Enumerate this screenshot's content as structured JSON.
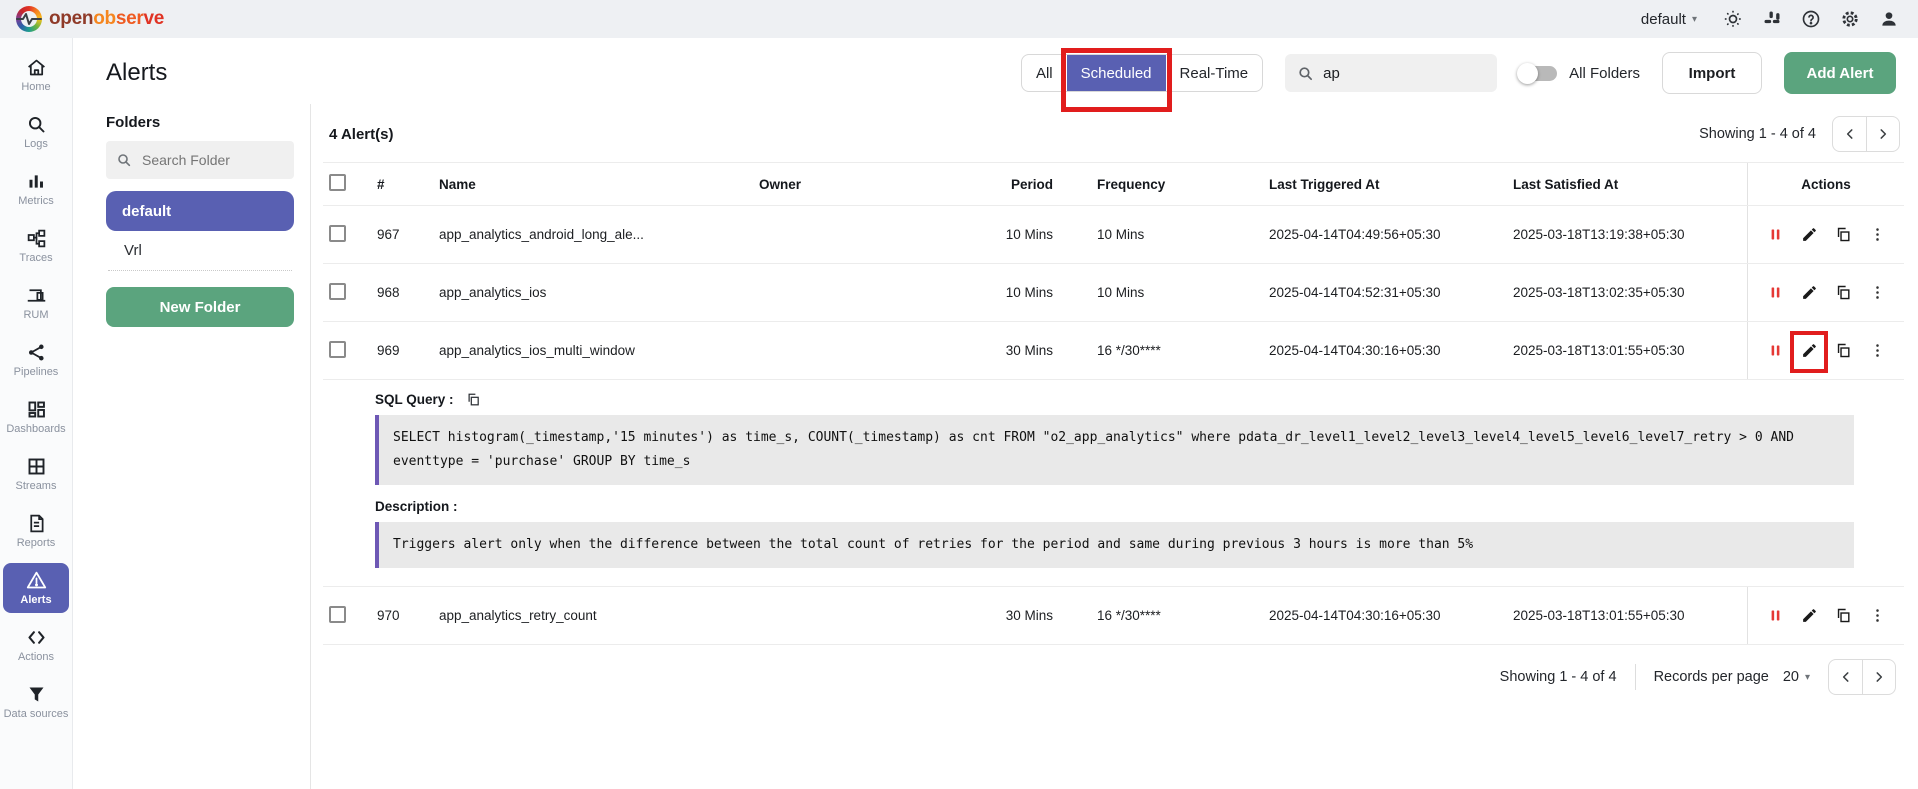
{
  "colors": {
    "accent_purple": "#5960b2",
    "button_green": "#5ba47e",
    "annotation_red": "#e11d1d",
    "pause_icon_red": "#e53935",
    "code_block_border_purple": "#6e58b5"
  },
  "topbar": {
    "brand_open": "open",
    "brand_ob": "ob",
    "brand_ser": "ser",
    "brand_ve": "ve",
    "org_selected": "default",
    "icons": [
      "theme-light-icon",
      "slack-icon",
      "help-icon",
      "settings-icon",
      "account-icon"
    ]
  },
  "sidebar": {
    "items": [
      {
        "label": "Home"
      },
      {
        "label": "Logs"
      },
      {
        "label": "Metrics"
      },
      {
        "label": "Traces"
      },
      {
        "label": "RUM"
      },
      {
        "label": "Pipelines"
      },
      {
        "label": "Dashboards"
      },
      {
        "label": "Streams"
      },
      {
        "label": "Reports"
      },
      {
        "label": "Alerts",
        "active": true
      },
      {
        "label": "Actions"
      },
      {
        "label": "Data sources"
      }
    ]
  },
  "header": {
    "title": "Alerts",
    "tabs": [
      {
        "label": "All"
      },
      {
        "label": "Scheduled",
        "active": true,
        "annotated": true
      },
      {
        "label": "Real-Time"
      }
    ],
    "search_value": "ap",
    "all_folders_label": "All Folders",
    "import_label": "Import",
    "add_alert_label": "Add Alert"
  },
  "folders": {
    "heading": "Folders",
    "search_placeholder": "Search Folder",
    "items": [
      {
        "label": "default",
        "active": true
      },
      {
        "label": "Vrl",
        "active": false
      }
    ],
    "new_folder_label": "New Folder"
  },
  "list": {
    "count": "4 Alert(s)",
    "showing": "Showing 1 - 4 of 4"
  },
  "table": {
    "headers": {
      "num": "#",
      "name": "Name",
      "owner": "Owner",
      "period": "Period",
      "frequency": "Frequency",
      "last_triggered": "Last Triggered At",
      "last_satisfied": "Last Satisfied At",
      "actions": "Actions"
    },
    "rows": [
      {
        "num": "967",
        "name": "app_analytics_android_long_ale...",
        "owner": "",
        "period": "10 Mins",
        "frequency": "10 Mins",
        "last_triggered": "2025-04-14T04:49:56+05:30",
        "last_satisfied": "2025-03-18T13:19:38+05:30"
      },
      {
        "num": "968",
        "name": "app_analytics_ios",
        "owner": "",
        "period": "10 Mins",
        "frequency": "10 Mins",
        "last_triggered": "2025-04-14T04:52:31+05:30",
        "last_satisfied": "2025-03-18T13:02:35+05:30"
      },
      {
        "num": "969",
        "name": "app_analytics_ios_multi_window",
        "owner": "",
        "period": "30 Mins",
        "frequency": "16 */30****",
        "last_triggered": "2025-04-14T04:30:16+05:30",
        "last_satisfied": "2025-03-18T13:01:55+05:30",
        "expanded": true,
        "edit_annotated": true
      },
      {
        "num": "970",
        "name": "app_analytics_retry_count",
        "owner": "",
        "period": "30 Mins",
        "frequency": "16 */30****",
        "last_triggered": "2025-04-14T04:30:16+05:30",
        "last_satisfied": "2025-03-18T13:01:55+05:30"
      }
    ]
  },
  "expanded": {
    "sql_label": "SQL Query :",
    "sql_text": "SELECT histogram(_timestamp,'15 minutes') as time_s, COUNT(_timestamp) as cnt FROM \"o2_app_analytics\" where pdata_dr_level1_level2_level3_level4_level5_level6_level7_retry > 0 AND eventtype = 'purchase' GROUP BY time_s",
    "description_label": "Description :",
    "description_text": "Triggers alert only when the difference between the total count of retries for the period and same during previous 3 hours is more than 5%"
  },
  "footer": {
    "showing": "Showing 1 - 4 of 4",
    "records_label": "Records per page",
    "records_value": "20"
  },
  "annotations": [
    {
      "target": "scheduled-tab",
      "shape": "red-box"
    },
    {
      "target": "row-969-edit-button",
      "shape": "red-box"
    }
  ]
}
